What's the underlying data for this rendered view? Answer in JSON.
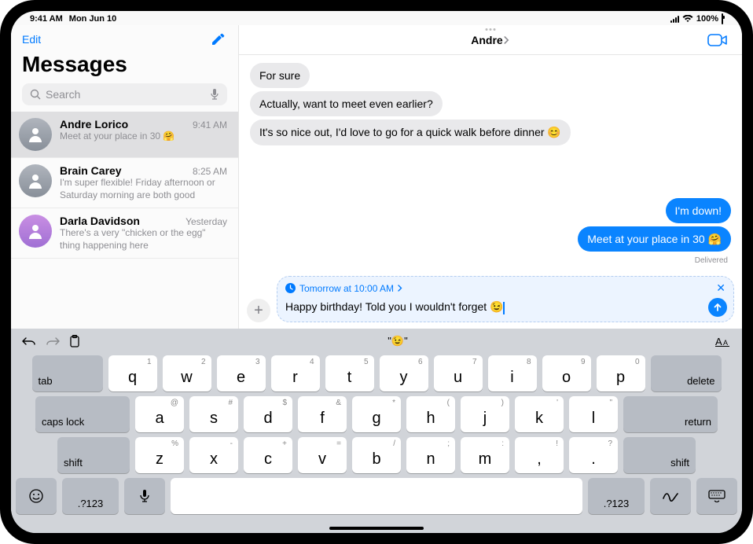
{
  "status": {
    "time": "9:41 AM",
    "date": "Mon Jun 10",
    "wifi": "wifi-icon",
    "battery": "100%"
  },
  "sidebar": {
    "edit_label": "Edit",
    "title": "Messages",
    "search_placeholder": "Search",
    "conversations": [
      {
        "name": "Andre Lorico",
        "time": "9:41 AM",
        "preview": "Meet at your place in 30 🤗",
        "selected": true
      },
      {
        "name": "Brain Carey",
        "time": "8:25 AM",
        "preview": "I'm super flexible! Friday afternoon or Saturday morning are both good",
        "selected": false
      },
      {
        "name": "Darla Davidson",
        "time": "Yesterday",
        "preview": "There's a very \"chicken or the egg\" thing happening here",
        "selected": false
      }
    ]
  },
  "conversation": {
    "contact_name": "Andre",
    "messages": [
      {
        "direction": "incoming",
        "text": "For sure"
      },
      {
        "direction": "incoming",
        "text": "Actually, want to meet even earlier?"
      },
      {
        "direction": "incoming",
        "text": "It's so nice out, I'd love to go for a quick walk before dinner 😊"
      },
      {
        "direction": "outgoing",
        "text": "I'm down!"
      },
      {
        "direction": "outgoing",
        "text": "Meet at your place in 30 🤗"
      }
    ],
    "delivered_label": "Delivered",
    "compose": {
      "reminder_label": "Tomorrow at 10:00 AM",
      "draft_text": "Happy birthday! Told you I wouldn't forget 😉"
    }
  },
  "keyboard": {
    "suggestion": "\"😉\"",
    "rows": [
      [
        {
          "main": "q",
          "hint": "1"
        },
        {
          "main": "w",
          "hint": "2"
        },
        {
          "main": "e",
          "hint": "3"
        },
        {
          "main": "r",
          "hint": "4"
        },
        {
          "main": "t",
          "hint": "5"
        },
        {
          "main": "y",
          "hint": "6"
        },
        {
          "main": "u",
          "hint": "7"
        },
        {
          "main": "i",
          "hint": "8"
        },
        {
          "main": "o",
          "hint": "9"
        },
        {
          "main": "p",
          "hint": "0"
        }
      ],
      [
        {
          "main": "a",
          "hint": "@"
        },
        {
          "main": "s",
          "hint": "#"
        },
        {
          "main": "d",
          "hint": "$"
        },
        {
          "main": "f",
          "hint": "&"
        },
        {
          "main": "g",
          "hint": "*"
        },
        {
          "main": "h",
          "hint": "("
        },
        {
          "main": "j",
          "hint": ")"
        },
        {
          "main": "k",
          "hint": "'"
        },
        {
          "main": "l",
          "hint": "\""
        }
      ],
      [
        {
          "main": "z",
          "hint": "%"
        },
        {
          "main": "x",
          "hint": "-"
        },
        {
          "main": "c",
          "hint": "+"
        },
        {
          "main": "v",
          "hint": "="
        },
        {
          "main": "b",
          "hint": "/"
        },
        {
          "main": "n",
          "hint": ";"
        },
        {
          "main": "m",
          "hint": ":"
        },
        {
          "main": ",",
          "hint": "!"
        },
        {
          "main": ".",
          "hint": "?"
        }
      ]
    ],
    "labels": {
      "tab": "tab",
      "delete": "delete",
      "caps": "caps lock",
      "return": "return",
      "shift": "shift",
      "numeric": ".?123"
    }
  }
}
